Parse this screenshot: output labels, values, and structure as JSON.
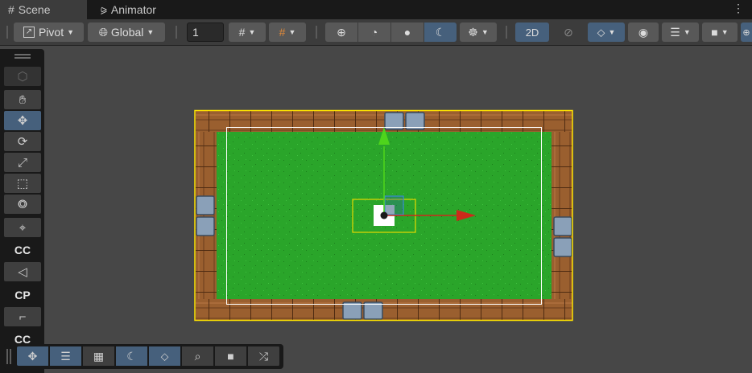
{
  "tabs": [
    {
      "label": "Scene",
      "icon": "grid-icon",
      "active": true
    },
    {
      "label": "Animator",
      "icon": "animator-icon",
      "active": false
    }
  ],
  "toolbar": {
    "pivot_label": "Pivot",
    "global_label": "Global",
    "grid_size_value": "1",
    "mode_2d_label": "2D"
  },
  "tools_panel": {
    "labels": [
      "CC",
      "CP",
      "CC"
    ]
  },
  "overlay_toolbar": {
    "icons": [
      "move-icon",
      "inspector-icon",
      "grid-icon",
      "shading-icon",
      "layers-icon",
      "search-icon",
      "camera-icon",
      "shuffle-icon"
    ]
  },
  "colors": {
    "selection_outline": "#ffe400",
    "grass": "#2aa52a",
    "wood": "#9a5f2f",
    "stone": "#8aa0b8",
    "x_axis": "#cc2a1a",
    "y_axis": "#4ed41c",
    "accent": "#46607c"
  }
}
